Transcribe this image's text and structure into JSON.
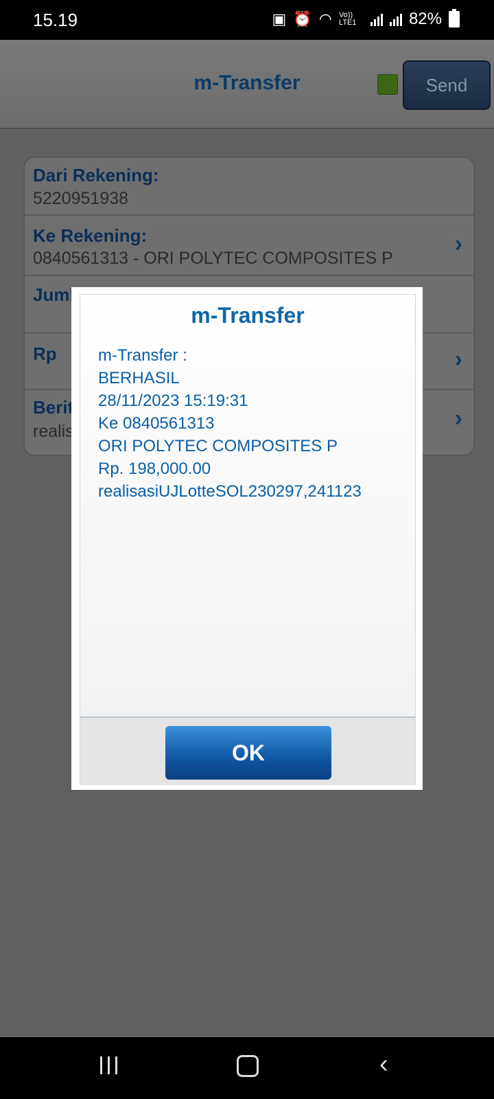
{
  "status_bar": {
    "time": "15.19",
    "network_label": "Vo)) LTE1",
    "battery_text": "82%"
  },
  "header": {
    "title": "m-Transfer",
    "send_label": "Send",
    "indicator_color": "#3f6516"
  },
  "form": {
    "from_label": "Dari Rekening:",
    "from_value": "5220951938",
    "to_label": "Ke Rekening:",
    "to_value": "0840561313 - ORI POLYTEC COMPOSITES P",
    "amount_label": "Jumla",
    "currency_label": "Rp",
    "note_label": "Berita",
    "note_value": "realis"
  },
  "dialog": {
    "title": "m-Transfer",
    "lines": [
      "m-Transfer :",
      "BERHASIL",
      "28/11/2023 15:19:31",
      "Ke 0840561313",
      "ORI POLYTEC COMPOSITES P",
      "Rp. 198,000.00",
      "realisasiUJLotteSOL230297,241123"
    ],
    "ok_label": "OK"
  },
  "icons": {
    "chevron": "chevron-right-icon",
    "recent": "recent-apps-icon",
    "home": "home-icon",
    "back": "back-icon"
  },
  "colors": {
    "title_blue": "#0b3d66",
    "dialog_text_blue": "#0b5fa5",
    "ok_button_blue": "#0f57a3"
  }
}
